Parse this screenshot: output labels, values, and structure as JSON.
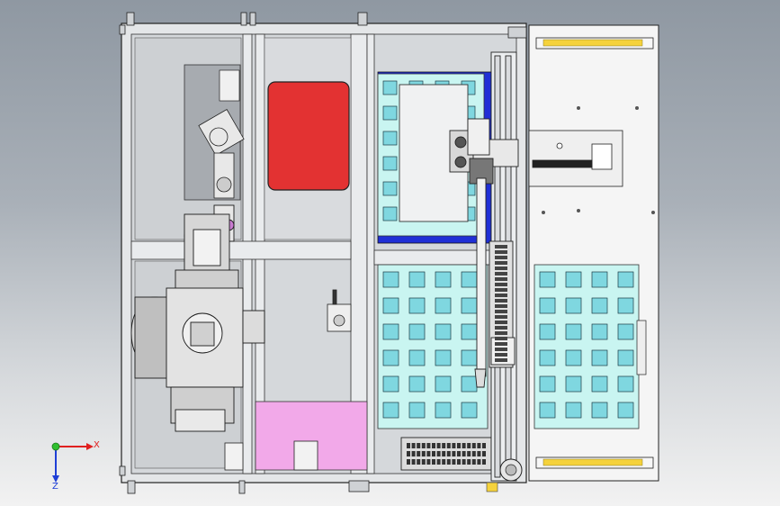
{
  "viewport": {
    "background_top": "#8f98a2",
    "background_bottom": "#f2f2f2"
  },
  "colors": {
    "frame": "#e6e8ea",
    "frame_line": "#2a2a2a",
    "panel": "#d3d6d9",
    "red_pad": "#e33232",
    "cyan_tray": "#c9f5f1",
    "cyan_cell": "#7fd7e0",
    "blue_rail": "#1f2fd6",
    "pink_zone": "#f2a9e9",
    "yellow_light": "#f5d23c",
    "axis_x": "#e02020",
    "axis_y": "#1f3fd6",
    "axis_z": "#2fbf2f"
  },
  "axes": {
    "x_label": "X",
    "z_label": "Z"
  }
}
